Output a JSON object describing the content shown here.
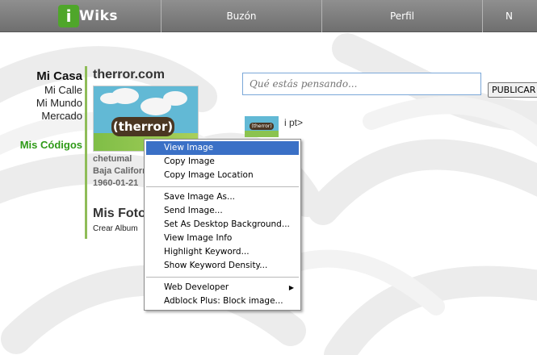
{
  "nav": {
    "logo_mark": "i",
    "logo_word": "Wiks",
    "tabs": [
      {
        "label": "Buzón"
      },
      {
        "label": "Perfil"
      },
      {
        "label": "N"
      }
    ]
  },
  "sidebar": {
    "items": [
      {
        "label": "Mi Casa"
      },
      {
        "label": "Mi Calle"
      },
      {
        "label": "Mi Mundo"
      },
      {
        "label": "Mercado"
      },
      {
        "label": "Mis Códigos"
      }
    ]
  },
  "profile": {
    "name": "therror.com",
    "image_badge": "(therror)",
    "city": "chetumal",
    "region": "Baja California",
    "birth_date": "1960-01-21",
    "section_title": "Mis Foto",
    "create_album": "Crear Album"
  },
  "status": {
    "placeholder": "Qué estás pensando...",
    "publish_label": "PUBLICAR"
  },
  "post": {
    "thumb_badge": "(therror)",
    "text": "i pt>"
  },
  "context_menu": {
    "items": [
      {
        "label": "View Image",
        "highlighted": true
      },
      {
        "label": "Copy Image"
      },
      {
        "label": "Copy Image Location"
      },
      {
        "separator": true
      },
      {
        "label": "Save Image As..."
      },
      {
        "label": "Send Image..."
      },
      {
        "label": "Set As Desktop Background..."
      },
      {
        "label": "View Image Info"
      },
      {
        "label": "Highlight Keyword..."
      },
      {
        "label": "Show Keyword Density..."
      },
      {
        "separator": true
      },
      {
        "label": "Web Developer",
        "submenu": true
      },
      {
        "label": "Adblock Plus: Block image..."
      }
    ]
  },
  "colors": {
    "accent_green": "#2f9a18",
    "menu_highlight": "#3a70c6",
    "topbar": "#7d7d7d"
  },
  "icons": {
    "submenu": "chevron-right-icon"
  }
}
